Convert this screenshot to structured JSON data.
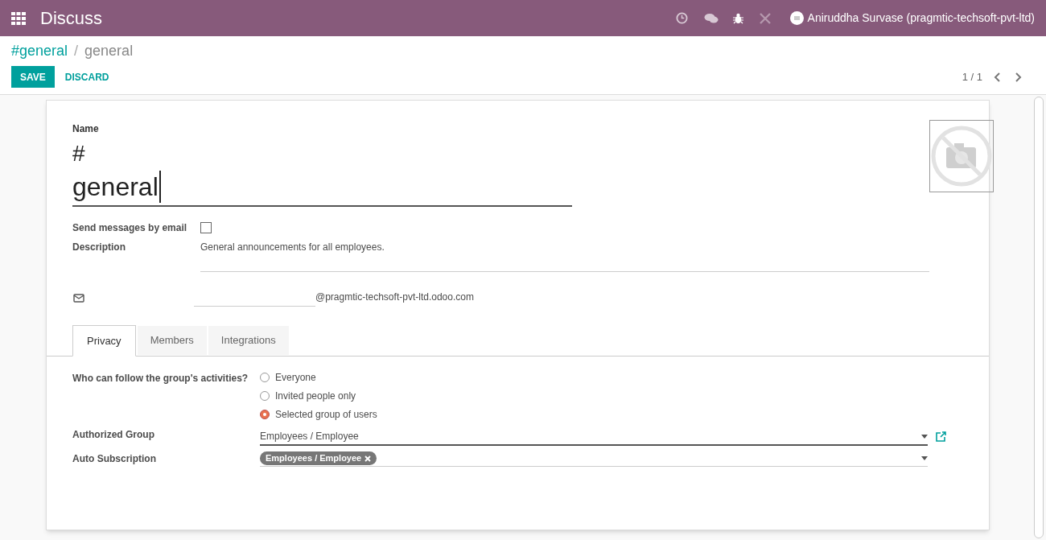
{
  "navbar": {
    "app_title": "Discuss",
    "user_name": "Aniruddha Survase (pragmtic-techsoft-pvt-ltd)"
  },
  "breadcrumb": [
    {
      "label": "#general",
      "link": true
    },
    {
      "label": "general",
      "link": false
    }
  ],
  "breadcrumb_separator": "/",
  "buttons": [
    {
      "label": "SAVE",
      "kind": "primary"
    },
    {
      "label": "DISCARD",
      "kind": "link"
    }
  ],
  "pager": "1 / 1",
  "form": {
    "name_label": "Name",
    "name_prefix": "#",
    "name_value": "general",
    "send_by_email": {
      "label": "Send messages by email",
      "checked": false
    },
    "description": {
      "label": "Description",
      "value": "General announcements for all employees."
    },
    "email_suffix": "@pragmtic-techsoft-pvt-ltd.odoo.com",
    "tabs": [
      {
        "label": "Privacy",
        "selected": true
      },
      {
        "label": "Members",
        "selected": false
      },
      {
        "label": "Integrations",
        "selected": false
      }
    ],
    "privacy": {
      "question": "Who can follow the group's activities?",
      "options": [
        {
          "label": "Everyone",
          "selected": false
        },
        {
          "label": "Invited people only",
          "selected": false
        },
        {
          "label": "Selected group of users",
          "selected": true
        }
      ],
      "authorized_group": {
        "label": "Authorized Group",
        "value": "Employees / Employee"
      },
      "auto_subscription": {
        "label": "Auto Subscription",
        "tags": [
          "Employees / Employee"
        ]
      }
    }
  }
}
